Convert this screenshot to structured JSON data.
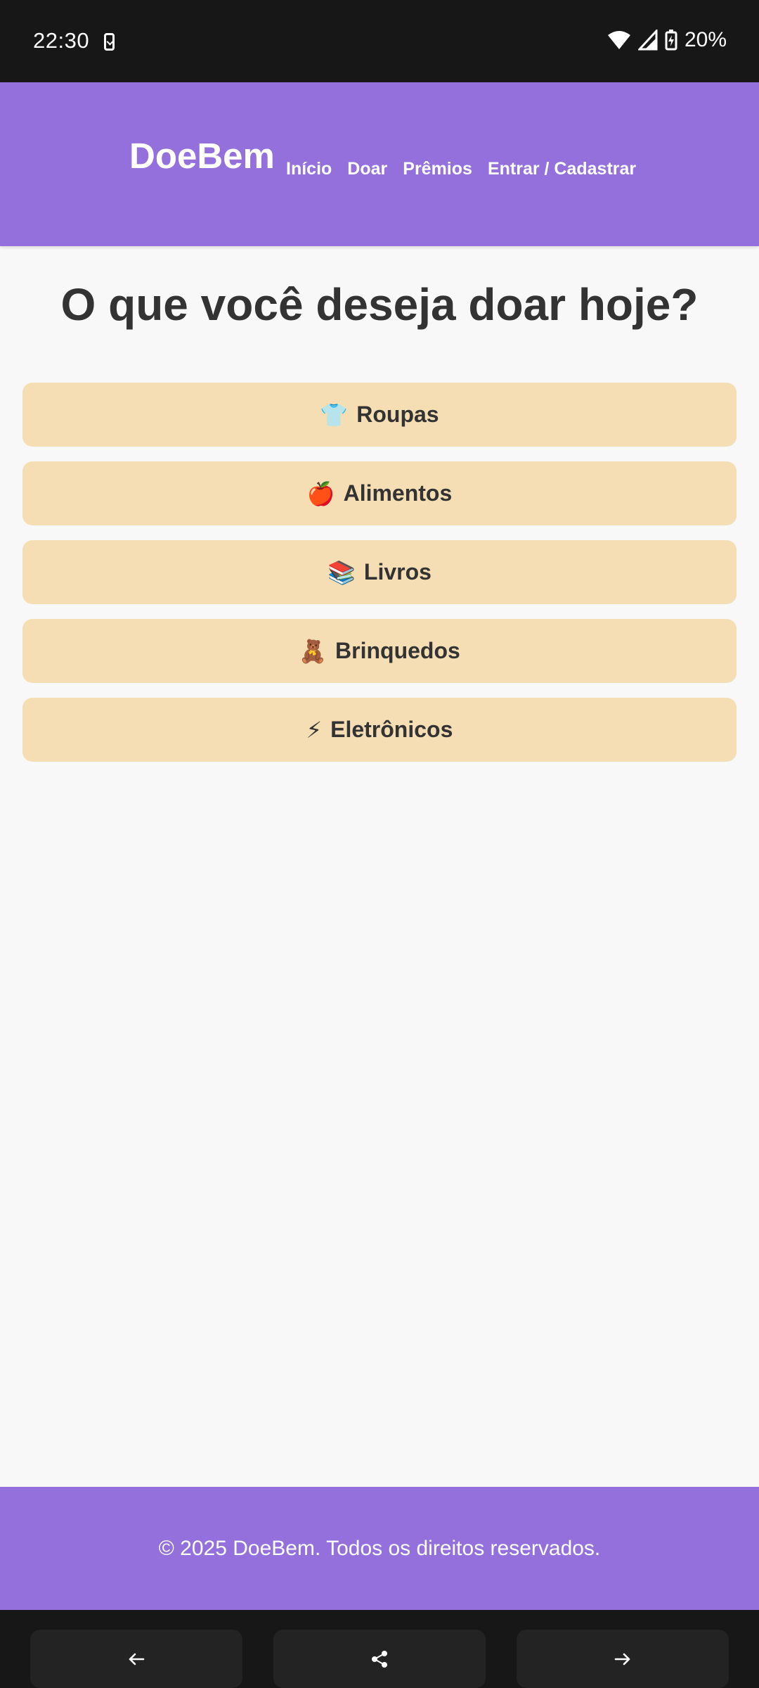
{
  "status_bar": {
    "time": "22:30",
    "battery": "20%",
    "icons": [
      "screenshot-phone-icon",
      "wifi-icon",
      "signal-icon",
      "battery-charging-icon"
    ]
  },
  "header": {
    "brand": "DoeBem",
    "nav": [
      "Início",
      "Doar",
      "Prêmios",
      "Entrar / Cadastrar"
    ],
    "color": "#9370db"
  },
  "main": {
    "title": "O que você deseja doar hoje?",
    "options": [
      {
        "emoji": "👕",
        "label": "Roupas"
      },
      {
        "emoji": "🍎",
        "label": "Alimentos"
      },
      {
        "emoji": "📚",
        "label": "Livros"
      },
      {
        "emoji": "🧸",
        "label": "Brinquedos"
      },
      {
        "emoji": "⚡",
        "label": "Eletrônicos"
      }
    ],
    "option_color": "#f5deb3"
  },
  "footer": {
    "text": "© 2025 DoeBem. Todos os direitos reservados."
  },
  "bottom_nav": {
    "buttons": [
      "back-arrow-icon",
      "share-icon",
      "forward-arrow-icon"
    ]
  }
}
